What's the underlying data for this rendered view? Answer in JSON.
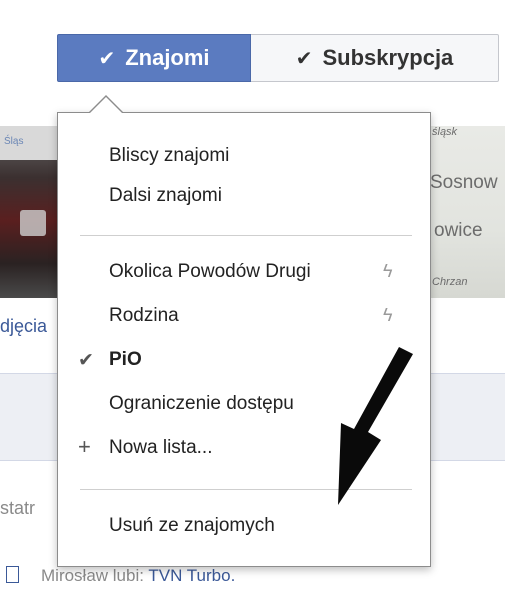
{
  "header": {
    "friends_button": {
      "icon": "check-icon",
      "label": "Znajomi",
      "color": "#5b7bc0"
    },
    "subscribe_button": {
      "icon": "check-icon",
      "label": "Subskrypcja"
    }
  },
  "menu": {
    "group1": [
      {
        "label": "Bliscy znajomi"
      },
      {
        "label": "Dalsi znajomi"
      }
    ],
    "group2": [
      {
        "label": "Okolica Powodów Drugi",
        "icon": "lightning-icon"
      },
      {
        "label": "Rodzina",
        "icon": "lightning-icon"
      },
      {
        "label": "PiO",
        "checked": true
      },
      {
        "label": "Ograniczenie dostępu"
      },
      {
        "label": "Nowa lista...",
        "icon": "plus-icon"
      }
    ],
    "group3": [
      {
        "label": "Usuń ze znajomych"
      }
    ]
  },
  "background": {
    "photo_tag": "Śląs",
    "map_labels": [
      "Sosnow",
      "owice",
      "Chrzan"
    ],
    "map_label_top": "śląsk",
    "link_photos": "djęcia",
    "text_fragment": "statr",
    "feed": {
      "text": "Mirosław lubi: ",
      "link": "TVN Turbo."
    }
  },
  "annotation": {
    "icon": "arrow-annotation-icon"
  }
}
